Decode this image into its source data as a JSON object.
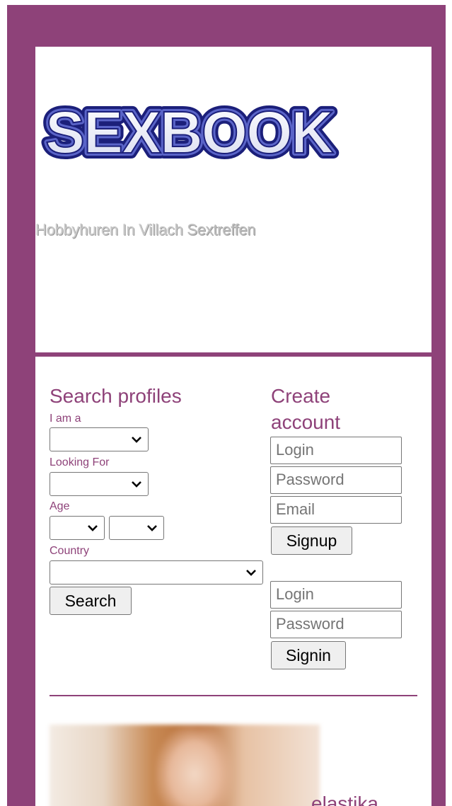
{
  "header": {
    "logo_text": "SEXBOOK",
    "tagline_bold": "Hobbyhuren In Villach",
    "tagline_rest": "Sextreffen"
  },
  "search": {
    "title": "Search profiles",
    "i_am_label": "I am a",
    "looking_for_label": "Looking For",
    "age_label": "Age",
    "country_label": "Country",
    "button": "Search"
  },
  "signup": {
    "title_line1": "Create",
    "title_line2": "account",
    "login_placeholder": "Login",
    "password_placeholder": "Password",
    "email_placeholder": "Email",
    "button": "Signup"
  },
  "signin": {
    "login_placeholder": "Login",
    "password_placeholder": "Password",
    "button": "Signin"
  },
  "profile_preview": {
    "name_partial": "elastika"
  },
  "colors": {
    "brand": "#8e4279"
  }
}
